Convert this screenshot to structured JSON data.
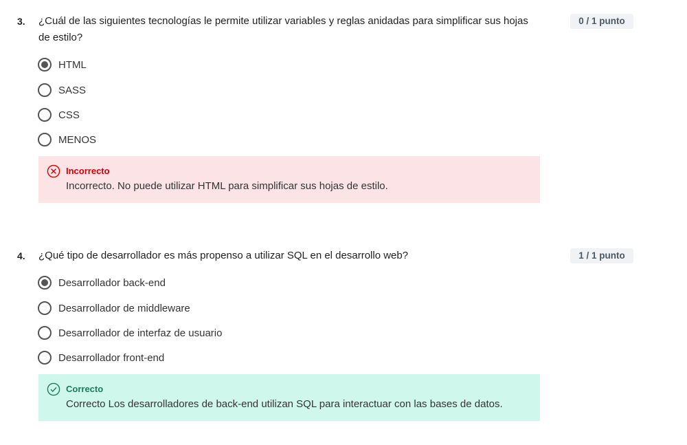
{
  "questions": [
    {
      "number": "3.",
      "text": "¿Cuál de las siguientes tecnologías le permite utilizar variables y reglas anidadas para simplificar sus hojas de estilo?",
      "score": "0 / 1 punto",
      "options": [
        {
          "label": "HTML",
          "selected": true
        },
        {
          "label": "SASS",
          "selected": false
        },
        {
          "label": "CSS",
          "selected": false
        },
        {
          "label": "MENOS",
          "selected": false
        }
      ],
      "feedback": {
        "status": "Incorrecto",
        "message": "Incorrecto. No puede utilizar HTML para simplificar sus hojas de estilo.",
        "icon": "x-circle-icon",
        "color": "#d30001",
        "bg": "#fbe3e6"
      }
    },
    {
      "number": "4.",
      "text": "¿Qué tipo de desarrollador es más propenso a utilizar SQL en el desarrollo web?",
      "score": "1 / 1 punto",
      "options": [
        {
          "label": "Desarrollador back-end",
          "selected": true
        },
        {
          "label": "Desarrollador de middleware",
          "selected": false
        },
        {
          "label": "Desarrollador de interfaz de usuario",
          "selected": false
        },
        {
          "label": "Desarrollador front-end",
          "selected": false
        }
      ],
      "feedback": {
        "status": "Correcto",
        "message": "Correcto Los desarrolladores de back-end utilizan SQL para interactuar con las bases de datos.",
        "icon": "check-circle-icon",
        "color": "#1b7c5a",
        "bg": "#d0f7ec"
      }
    }
  ]
}
